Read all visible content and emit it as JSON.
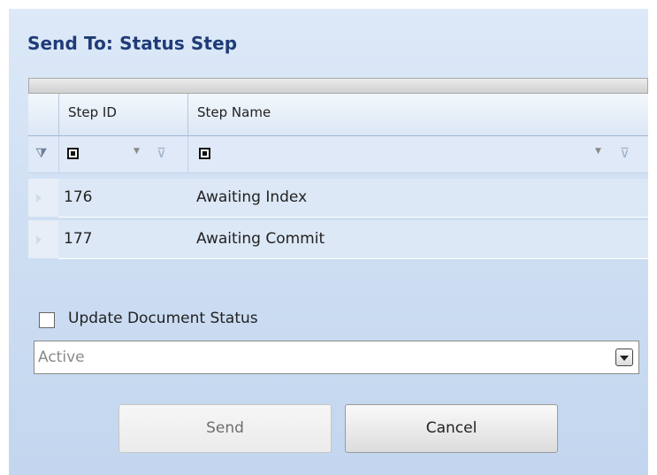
{
  "dialog": {
    "title": "Send To: Status Step"
  },
  "grid": {
    "columns": [
      {
        "label": "Step ID"
      },
      {
        "label": "Step Name"
      }
    ],
    "rows": [
      {
        "step_id": "176",
        "step_name": "Awaiting Index"
      },
      {
        "step_id": "177",
        "step_name": "Awaiting Commit"
      }
    ]
  },
  "status": {
    "checkbox_label": "Update Document Status",
    "checked": false,
    "selected_value": "Active"
  },
  "buttons": {
    "send": "Send",
    "cancel": "Cancel"
  },
  "icons": {
    "filter_row": "filter-options-icon",
    "filter_clear": "clear-filter-icon",
    "dropdown": "chevron-down-icon",
    "row_indicator": "row-pointer-icon"
  }
}
